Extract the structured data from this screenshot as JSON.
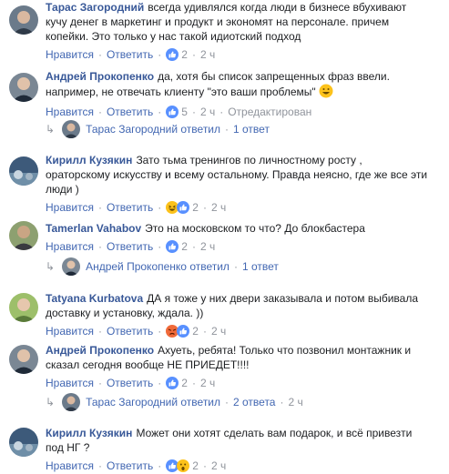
{
  "comments": [
    {
      "author": "Тарас Загородний",
      "text_lines": [
        "всегда удивлялся когда люди в бизнесе вбухивают",
        "кучу денег в маркетинг и продукт и экономят на персонале. причем",
        "копейки. Это только у нас такой идиотский подход"
      ],
      "like": "Нравится",
      "reply": "Ответить",
      "time": "2 ч",
      "reactions": [
        "like"
      ],
      "count": "2"
    },
    {
      "author": "Андрей Прокопенко",
      "text_lines": [
        "да, хотя бы список запрещенных фраз ввели.",
        "например, не отвечать клиенту \"это ваши проблемы\""
      ],
      "like": "Нравится",
      "reply": "Ответить",
      "time": "2 ч",
      "reactions": [
        "like"
      ],
      "count": "5",
      "edited": "Отредактирован",
      "replies": {
        "name": "Тарас Загородний",
        "verb": "ответил",
        "count": "1 ответ"
      }
    },
    {
      "author": "Кирилл Кузякин",
      "text_lines": [
        "Зато тьма тренингов по личностному росту ,",
        "ораторскому искусству и всему остальному. Правда неясно, где же все эти",
        "люди )"
      ],
      "like": "Нравится",
      "reply": "Ответить",
      "time": "2 ч",
      "reactions": [
        "haha",
        "like"
      ],
      "count": "2"
    },
    {
      "author": "Tamerlan Vahabov",
      "text_lines": [
        "Это на московском то что? До блокбастера"
      ],
      "like": "Нравится",
      "reply": "Ответить",
      "time": "2 ч",
      "reactions": [
        "like"
      ],
      "count": "2",
      "replies": {
        "name": "Андрей Прокопенко",
        "verb": "ответил",
        "count": "1 ответ"
      }
    },
    {
      "author": "Tatyana Kurbatova",
      "text_lines": [
        "ДА я тоже у них двери заказывала и потом выбивала",
        "доставку и установку, ждала. ))"
      ],
      "like": "Нравится",
      "reply": "Ответить",
      "time": "2 ч",
      "reactions": [
        "angry",
        "like"
      ],
      "count": "2"
    },
    {
      "author": "Андрей Прокопенко",
      "text_lines": [
        "Ахуеть, ребята! Только что позвонил монтажник и",
        "сказал сегодня вообще НЕ ПРИЕДЕТ!!!!"
      ],
      "like": "Нравится",
      "reply": "Ответить",
      "time": "2 ч",
      "reactions": [
        "like"
      ],
      "count": "2",
      "replies": {
        "name": "Тарас Загородний",
        "verb": "ответил",
        "count": "2 ответа",
        "time": "2 ч"
      }
    },
    {
      "author": "Кирилл Кузякин",
      "text_lines": [
        "Может они хотят сделать вам подарок, и всё привезти",
        "под НГ ?"
      ],
      "like": "Нравится",
      "reply": "Ответить",
      "time": "2 ч",
      "reactions": [
        "like",
        "wow"
      ],
      "count": "2"
    }
  ],
  "colors": {
    "link": "#385898",
    "action": "#4267b2",
    "meta": "#90949c",
    "like": "#5890ff"
  }
}
